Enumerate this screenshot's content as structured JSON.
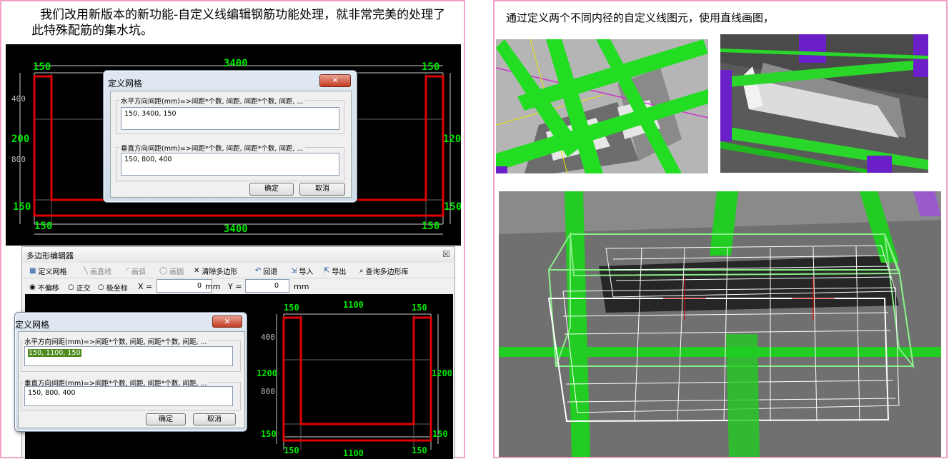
{
  "left_panel": {
    "caption": "我们改用新版本的新功能-自定义线编辑钢筋功能处理，就非常完美的处理了此特殊配筋的集水坑。"
  },
  "right_panel": {
    "caption": "通过定义两个不同内径的自定义线图元，使用直线画图，"
  },
  "top_cad": {
    "dims": {
      "top_left": "150",
      "top_center": "3400",
      "top_right": "150",
      "bottom_left": "150",
      "bottom_center": "3400",
      "bottom_right": "150",
      "left_mid": "200",
      "right_mid": "120",
      "left_bottom": "150",
      "right_bottom": "150",
      "left_tick_1": "400",
      "left_tick_2": "800"
    },
    "dialog": {
      "title": "定义网格",
      "close": "✕",
      "h_label": "水平方向间距(mm)=>间距*个数, 间距, 间距*个数, 间距, ...",
      "h_value": "150, 3400, 150",
      "v_label": "垂直方向间距(mm)=>间距*个数, 间距, 间距*个数, 间距, ...",
      "v_value": "150, 800, 400",
      "ok": "确定",
      "cancel": "取消"
    }
  },
  "editor": {
    "title": "多边形编辑器",
    "close": "☒",
    "toolbar": {
      "define_grid": "定义网格",
      "draw_line": "画直线",
      "draw_arc": "画弧",
      "draw_circle": "画圆",
      "clear": "清除多边形",
      "undo": "回退",
      "import": "导入",
      "export": "导出",
      "query": "查询多边形库"
    },
    "options": {
      "no_offset": "不偏移",
      "ortho": "正交",
      "polar": "极坐标",
      "x_label": "X =",
      "x_value": "0",
      "x_unit": "mm",
      "y_label": "Y =",
      "y_value": "0",
      "y_unit": "mm"
    },
    "dims": {
      "top_left": "150",
      "top_center": "1100",
      "top_right": "150",
      "bottom_left": "150",
      "bottom_center": "1100",
      "bottom_right": "150",
      "left_mid": "1200",
      "right_mid": "1200",
      "left_bottom": "150",
      "right_bottom": "150",
      "left_tick_1": "400",
      "left_tick_2": "800"
    },
    "dialog": {
      "title": "定义网格",
      "close": "✕",
      "h_label": "水平方向间距(mm)=>间距*个数, 间距, 间距*个数, 间距, ...",
      "h_value": "150, 1100, 150",
      "v_label": "垂直方向间距(mm)=>间距*个数, 间距, 间距*个数, 间距, ...",
      "v_value": "150, 800, 400",
      "ok": "确定",
      "cancel": "取消"
    }
  },
  "colors": {
    "frame": "#f2a2c8",
    "rebar": "#00cc00",
    "outline": "#e00000",
    "dim_text": "#00e600",
    "purple": "#6a1fc8"
  }
}
